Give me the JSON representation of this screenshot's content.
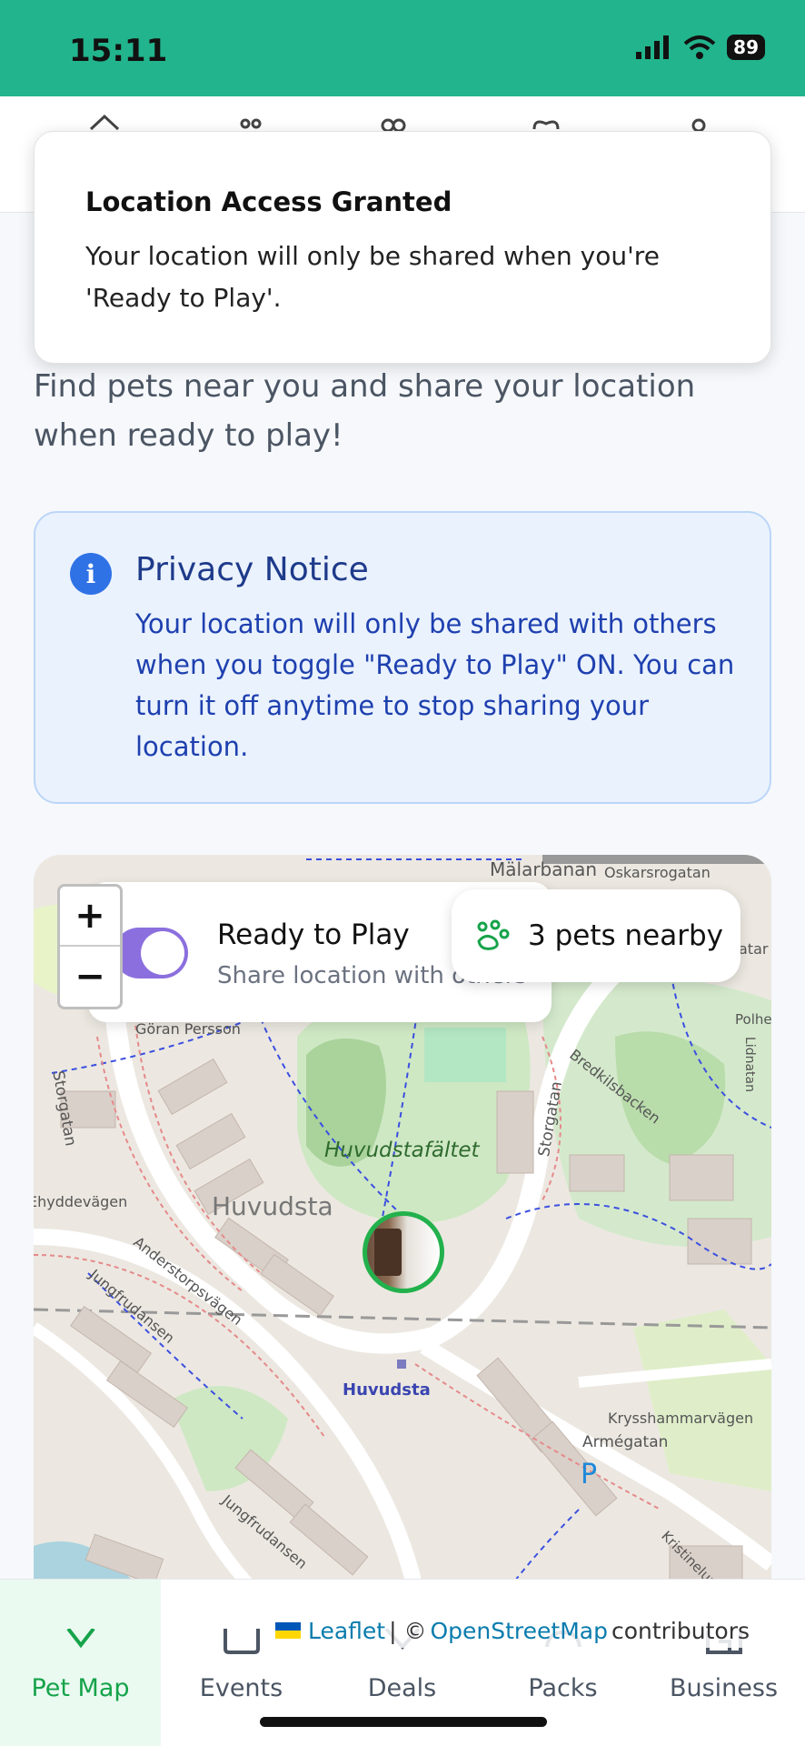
{
  "status_bar": {
    "time": "15:11",
    "battery": "89"
  },
  "toast": {
    "title": "Location Access Granted",
    "message": "Your location will only be shared when you're 'Ready to Play'."
  },
  "intro": "Find pets near you and share your location when ready to play!",
  "privacy_notice": {
    "title": "Privacy Notice",
    "body": "Your location will only be shared with others when you toggle \"Ready to Play\" ON. You can turn it off anytime to stop sharing your location."
  },
  "map": {
    "zoom_in": "+",
    "zoom_out": "−",
    "ready_to_play": {
      "title": "Ready to Play",
      "subtitle": "Share location with others",
      "enabled": true
    },
    "pets_nearby": "3 pets nearby",
    "labels": {
      "malarbanan": "Mälarbanan",
      "oskarsrogatan": "Oskarsrogatan",
      "goran": "Göran Persson",
      "storgatan_left": "Storgatan",
      "storgatan_right": "Storgatan",
      "huvudstafaltet": "Huvudstafältet",
      "huvudsta": "Huvudsta",
      "huvudsta_station": "Huvudsta",
      "hyddevagen": "Ehyddevägen",
      "andersstorpsvagen": "Anderstorpsvägen",
      "jungfrudansen_top": "Jungfrudansen",
      "jungfrudansen_bottom": "Jungfrudansen",
      "bredkilsbacken": "Bredkilsbacken",
      "krysshammarvagen": "Krysshammarvägen",
      "armegatan": "Armégatan",
      "kristinelund": "Kristineluna",
      "polhe": "Polhe",
      "lidnatan": "Lidnatan",
      "atar": "atar",
      "parking": "P"
    },
    "attribution": {
      "leaflet": "Leaflet",
      "separator": "| ©",
      "osm": "OpenStreetMap",
      "contributors": "contributors"
    }
  },
  "bottom_nav": {
    "tabs": [
      {
        "label": "Pet Map",
        "active": true
      },
      {
        "label": "Events",
        "active": false
      },
      {
        "label": "Deals",
        "active": false
      },
      {
        "label": "Packs",
        "active": false
      },
      {
        "label": "Business",
        "active": false
      }
    ]
  },
  "colors": {
    "accent": "#22b48c",
    "toggle": "#8b6fde",
    "active_tab": "#16a34a",
    "notice_bg": "#eaf2fe",
    "notice_text": "#1e40af"
  },
  "icons": {
    "top_nav": [
      "home-icon",
      "paw-icon",
      "users-icon",
      "heart-icon",
      "profile-icon"
    ],
    "bottom_nav": [
      "map-pin-icon",
      "calendar-icon",
      "tag-icon",
      "bag-icon",
      "store-icon"
    ]
  }
}
